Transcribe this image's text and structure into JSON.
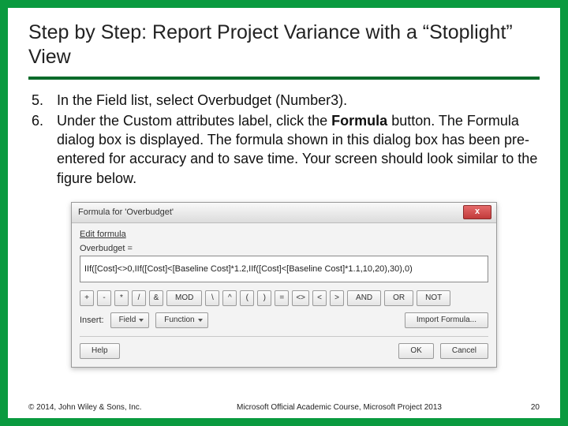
{
  "title": "Step by Step: Report Project Variance with a “Stoplight” View",
  "steps": [
    {
      "num": "5.",
      "text_before": "In the Field list, select Overbudget (Number3).",
      "bold": "",
      "text_after": ""
    },
    {
      "num": "6.",
      "text_before": "Under the Custom attributes label, click the ",
      "bold": "Formula",
      "text_after": " button. The Formula dialog box is displayed. The formula shown in this dialog box has been pre-entered for accuracy and to save time. Your screen should look similar to the figure below."
    }
  ],
  "dialog": {
    "title": "Formula for 'Overbudget'",
    "close": "x",
    "edit_label": "Edit formula",
    "field_label": "Overbudget =",
    "formula": "IIf([Cost]<>0,IIf([Cost]<[Baseline Cost]*1.2,IIf([Cost]<[Baseline Cost]*1.1,10,20),30),0)",
    "ops": [
      "+",
      "-",
      "*",
      "/",
      "&",
      "MOD",
      "\\",
      "^",
      "(",
      ")",
      "=",
      "<>",
      "<",
      ">",
      "AND",
      "OR",
      "NOT"
    ],
    "insert_label": "Insert:",
    "field_btn": "Field",
    "function_btn": "Function",
    "import_btn": "Import Formula...",
    "help": "Help",
    "ok": "OK",
    "cancel": "Cancel"
  },
  "footer": {
    "copyright": "© 2014, John Wiley & Sons, Inc.",
    "course": "Microsoft Official Academic Course, Microsoft Project 2013",
    "page": "20"
  }
}
